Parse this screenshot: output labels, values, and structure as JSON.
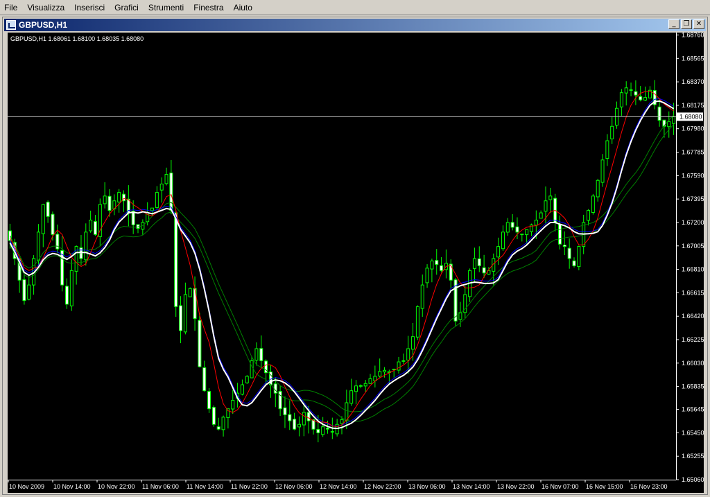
{
  "menu": [
    "File",
    "Visualizza",
    "Inserisci",
    "Grafici",
    "Strumenti",
    "Finestra",
    "Aiuto"
  ],
  "window": {
    "title": "GBPUSD,H1",
    "buttons": {
      "minimize": "_",
      "restore": "❐",
      "close": "✕"
    }
  },
  "chart_data": {
    "type": "candlestick",
    "title": "GBPUSD,H1  1.68061 1.68100 1.68035 1.68080",
    "current_price_label": "1.68080",
    "current_price": 1.6808,
    "ylim": [
      1.6506,
      1.6878
    ],
    "y_ticks": [
      "1.68760",
      "1.68565",
      "1.68370",
      "1.68175",
      "1.67980",
      "1.67785",
      "1.67590",
      "1.67395",
      "1.67200",
      "1.67005",
      "1.66810",
      "1.66615",
      "1.66420",
      "1.66225",
      "1.66030",
      "1.65835",
      "1.65645",
      "1.65450",
      "1.65255",
      "1.65060"
    ],
    "x_ticks": [
      "10 Nov 2009",
      "10 Nov 14:00",
      "10 Nov 22:00",
      "11 Nov 06:00",
      "11 Nov 14:00",
      "11 Nov 22:00",
      "12 Nov 06:00",
      "12 Nov 14:00",
      "12 Nov 22:00",
      "13 Nov 06:00",
      "13 Nov 14:00",
      "13 Nov 22:00",
      "16 Nov 07:00",
      "16 Nov 15:00",
      "16 Nov 23:00"
    ],
    "close_series": [
      1.6705,
      1.669,
      1.6672,
      1.6655,
      1.6668,
      1.669,
      1.6712,
      1.6735,
      1.6725,
      1.671,
      1.6698,
      1.6668,
      1.6652,
      1.668,
      1.67,
      1.669,
      1.6712,
      1.6722,
      1.671,
      1.6735,
      1.6742,
      1.673,
      1.6738,
      1.6745,
      1.6738,
      1.6728,
      1.6718,
      1.6715,
      1.672,
      1.6728,
      1.6732,
      1.6745,
      1.6752,
      1.676,
      1.673,
      1.665,
      1.663,
      1.666,
      1.6665,
      1.664,
      1.66,
      1.658,
      1.6565,
      1.6552,
      1.6548,
      1.6558,
      1.6565,
      1.6572,
      1.6578,
      1.6585,
      1.6592,
      1.6605,
      1.6615,
      1.6605,
      1.6595,
      1.6585,
      1.6578,
      1.6565,
      1.656,
      1.6555,
      1.6548,
      1.6552,
      1.6562,
      1.6555,
      1.6548,
      1.6545,
      1.655,
      1.6548,
      1.6546,
      1.6552,
      1.6556,
      1.657,
      1.658,
      1.6584,
      1.6584,
      1.6586,
      1.659,
      1.6592,
      1.6596,
      1.6597,
      1.6596,
      1.6598,
      1.6604,
      1.6605,
      1.6615,
      1.6625,
      1.665,
      1.6668,
      1.6682,
      1.6688,
      1.6685,
      1.668,
      1.6686,
      1.6672,
      1.6638,
      1.6645,
      1.666,
      1.668,
      1.669,
      1.6684,
      1.6678,
      1.668,
      1.669,
      1.67,
      1.6712,
      1.672,
      1.6716,
      1.6712,
      1.671,
      1.6714,
      1.6718,
      1.6722,
      1.6728,
      1.6738,
      1.6742,
      1.672,
      1.6702,
      1.67,
      1.669,
      1.6684,
      1.67,
      1.672,
      1.673,
      1.6742,
      1.6755,
      1.6772,
      1.6788,
      1.68,
      1.6815,
      1.6828,
      1.6832,
      1.683,
      1.6826,
      1.6822,
      1.6824,
      1.683,
      1.6818,
      1.6805,
      1.68,
      1.6804,
      1.6808
    ]
  }
}
